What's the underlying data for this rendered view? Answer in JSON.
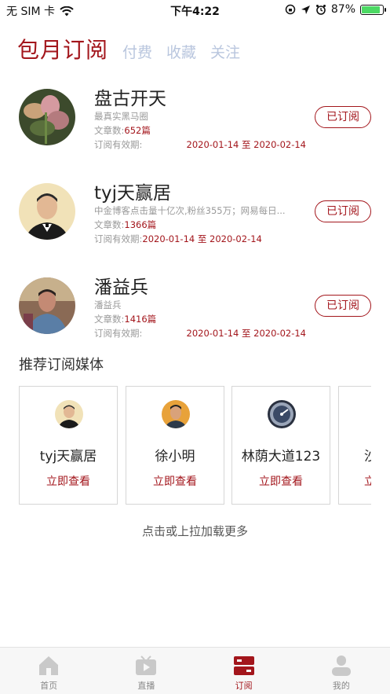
{
  "status_bar": {
    "carrier": "无 SIM 卡",
    "time": "下午4:22",
    "battery": "87%",
    "battery_level": 0.87
  },
  "top_tabs": {
    "active": "包月订阅",
    "paid": "付费",
    "favorites": "收藏",
    "follow": "关注"
  },
  "subscriptions": [
    {
      "name": "盘古开天",
      "desc": "最真实黑马圈",
      "count_label": "文章数:",
      "count": "652篇",
      "period_label": "订阅有效期:",
      "period": "2020-01-14 至 2020-02-14",
      "button": "已订阅"
    },
    {
      "name": "tyj天赢居",
      "desc": "中金博客点击量十亿次,粉丝355万；网易每日...",
      "count_label": "文章数:",
      "count": "1366篇",
      "period_label": "订阅有效期:",
      "period": "2020-01-14 至 2020-02-14",
      "button": "已订阅"
    },
    {
      "name": "潘益兵",
      "desc": "潘益兵",
      "count_label": "文章数:",
      "count": "1416篇",
      "period_label": "订阅有效期:",
      "period": "2020-01-14 至 2020-02-14",
      "button": "已订阅"
    }
  ],
  "recommend": {
    "title": "推荐订阅媒体",
    "cards": [
      {
        "name": "tyj天赢居",
        "link": "立即查看"
      },
      {
        "name": "徐小明",
        "link": "立即查看"
      },
      {
        "name": "林荫大道123",
        "link": "立即查看"
      },
      {
        "name": "沙",
        "link": "立"
      }
    ]
  },
  "load_more": "点击或上拉加载更多",
  "tabbar": {
    "home": "首页",
    "live": "直播",
    "subscribe": "订阅",
    "mine": "我的"
  },
  "colors": {
    "accent": "#a3161c",
    "inactive_tab": "#b9c6de"
  }
}
